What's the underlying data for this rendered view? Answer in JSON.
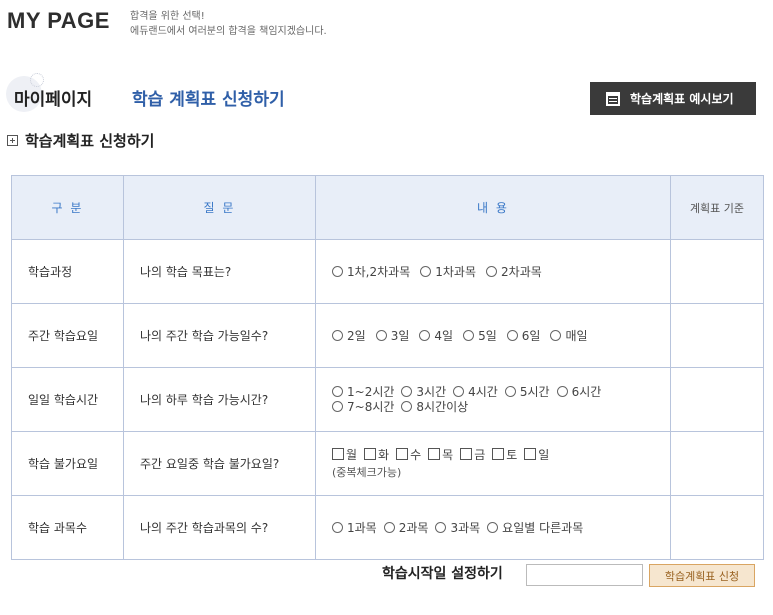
{
  "header": {
    "title": "MY PAGE",
    "subtitle_line1": "합격을 위한 선택!",
    "subtitle_line2": "에듀랜드에서 여러분의 합격을 책임지겠습니다."
  },
  "breadcrumb": {
    "home": "마이페이지",
    "current": "학습 계획표 신청하기"
  },
  "preview_button": {
    "label": "학습계획표 예시보기",
    "icon": "calendar-icon"
  },
  "section": {
    "title": "학습계획표 신청하기",
    "icon": "plus-box-icon"
  },
  "table": {
    "headers": [
      "구 분",
      "질 문",
      "내 용",
      "계획표 기준"
    ],
    "rows": [
      {
        "category": "학습과정",
        "question": "나의 학습 목표는?",
        "type": "radio",
        "options": [
          "1차,2차과목",
          "1차과목",
          "2차과목"
        ]
      },
      {
        "category": "주간 학습요일",
        "question": "나의 주간 학습 가능일수?",
        "type": "radio",
        "options": [
          "2일",
          "3일",
          "4일",
          "5일",
          "6일",
          "매일"
        ]
      },
      {
        "category": "일일 학습시간",
        "question": "나의 하루 학습 가능시간?",
        "type": "radio",
        "options": [
          "1~2시간",
          "3시간",
          "4시간",
          "5시간",
          "6시간",
          "7~8시간",
          "8시간이상"
        ]
      },
      {
        "category": "학습 불가요일",
        "question": "주간 요일중 학습 불가요일?",
        "type": "checkbox",
        "options": [
          "월",
          "화",
          "수",
          "목",
          "금",
          "토",
          "일"
        ],
        "note": "(중복체크가능)"
      },
      {
        "category": "학습 과목수",
        "question": "나의 주간 학습과목의 수?",
        "type": "radio",
        "options": [
          "1과목",
          "2과목",
          "3과목",
          "요일별 다른과목"
        ]
      }
    ]
  },
  "start": {
    "label": "학습시작일 설정하기",
    "input_value": "",
    "button_label": "학습계획표 신청"
  },
  "colors": {
    "accent_blue": "#2f5fa8",
    "header_bg": "#e8eef8",
    "border": "#b8c4dc",
    "dark_button": "#3a3a3a",
    "apply_button_bg": "#f6e6cf"
  }
}
